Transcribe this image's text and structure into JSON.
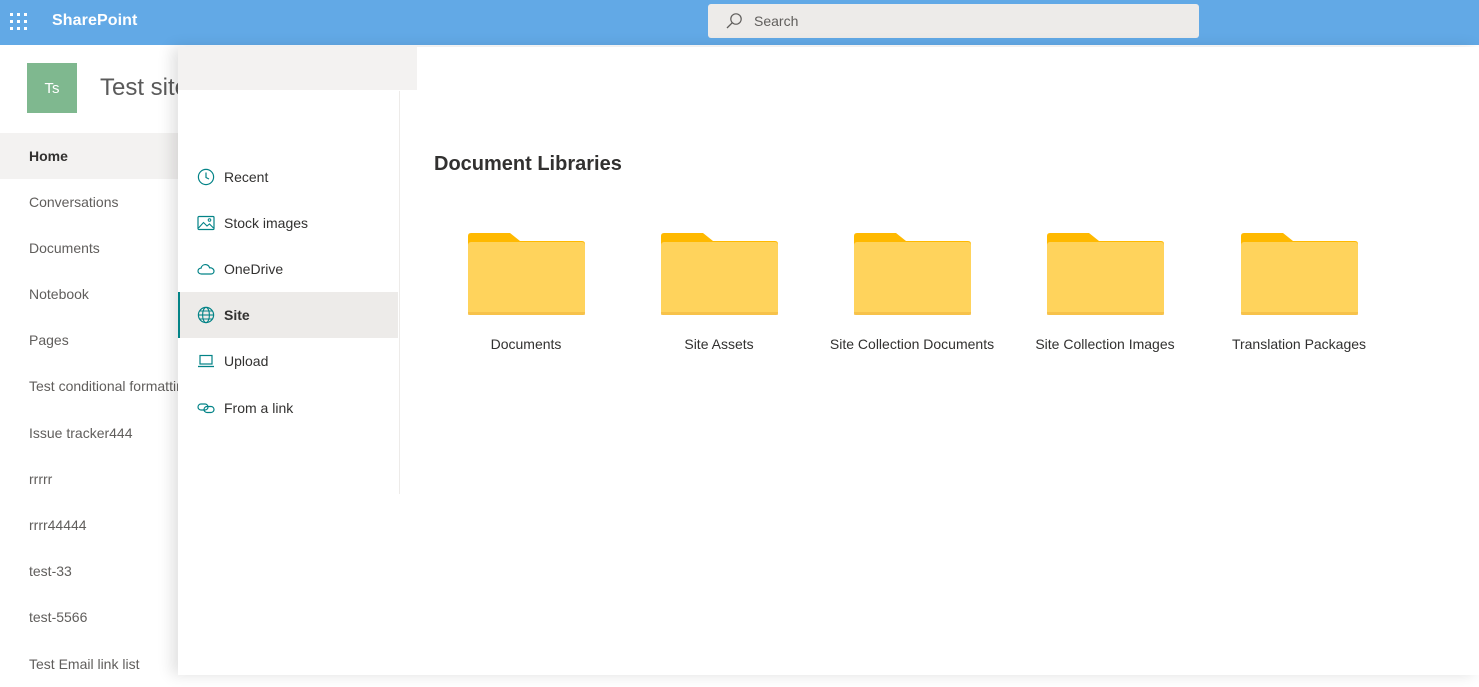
{
  "suitebar": {
    "app_name": "SharePoint",
    "search_placeholder": "Search",
    "color": "#62a9e6"
  },
  "site": {
    "logo_initials": "Ts",
    "logo_color": "#7fb88f",
    "title": "Test site",
    "nav": [
      {
        "label": "Home",
        "active": true
      },
      {
        "label": "Conversations"
      },
      {
        "label": "Documents"
      },
      {
        "label": "Notebook"
      },
      {
        "label": "Pages"
      },
      {
        "label": "Test conditional formatting"
      },
      {
        "label": "Issue tracker444"
      },
      {
        "label": "rrrrr"
      },
      {
        "label": "rrrr44444"
      },
      {
        "label": "test-33"
      },
      {
        "label": "test-5566"
      },
      {
        "label": "Test Email link list"
      }
    ]
  },
  "panel": {
    "nav": [
      {
        "label": "Recent",
        "icon": "clock-icon"
      },
      {
        "label": "Stock images",
        "icon": "image-icon"
      },
      {
        "label": "OneDrive",
        "icon": "cloud-icon"
      },
      {
        "label": "Site",
        "icon": "globe-icon",
        "active": true
      },
      {
        "label": "Upload",
        "icon": "laptop-icon"
      },
      {
        "label": "From a link",
        "icon": "link-icon"
      }
    ],
    "section_title": "Document Libraries",
    "libraries": [
      {
        "label": "Documents"
      },
      {
        "label": "Site Assets"
      },
      {
        "label": "Site Collection Documents"
      },
      {
        "label": "Site Collection Images"
      },
      {
        "label": "Translation Packages"
      }
    ],
    "accent_color": "#038387",
    "folder_color": "#ffd35c"
  }
}
